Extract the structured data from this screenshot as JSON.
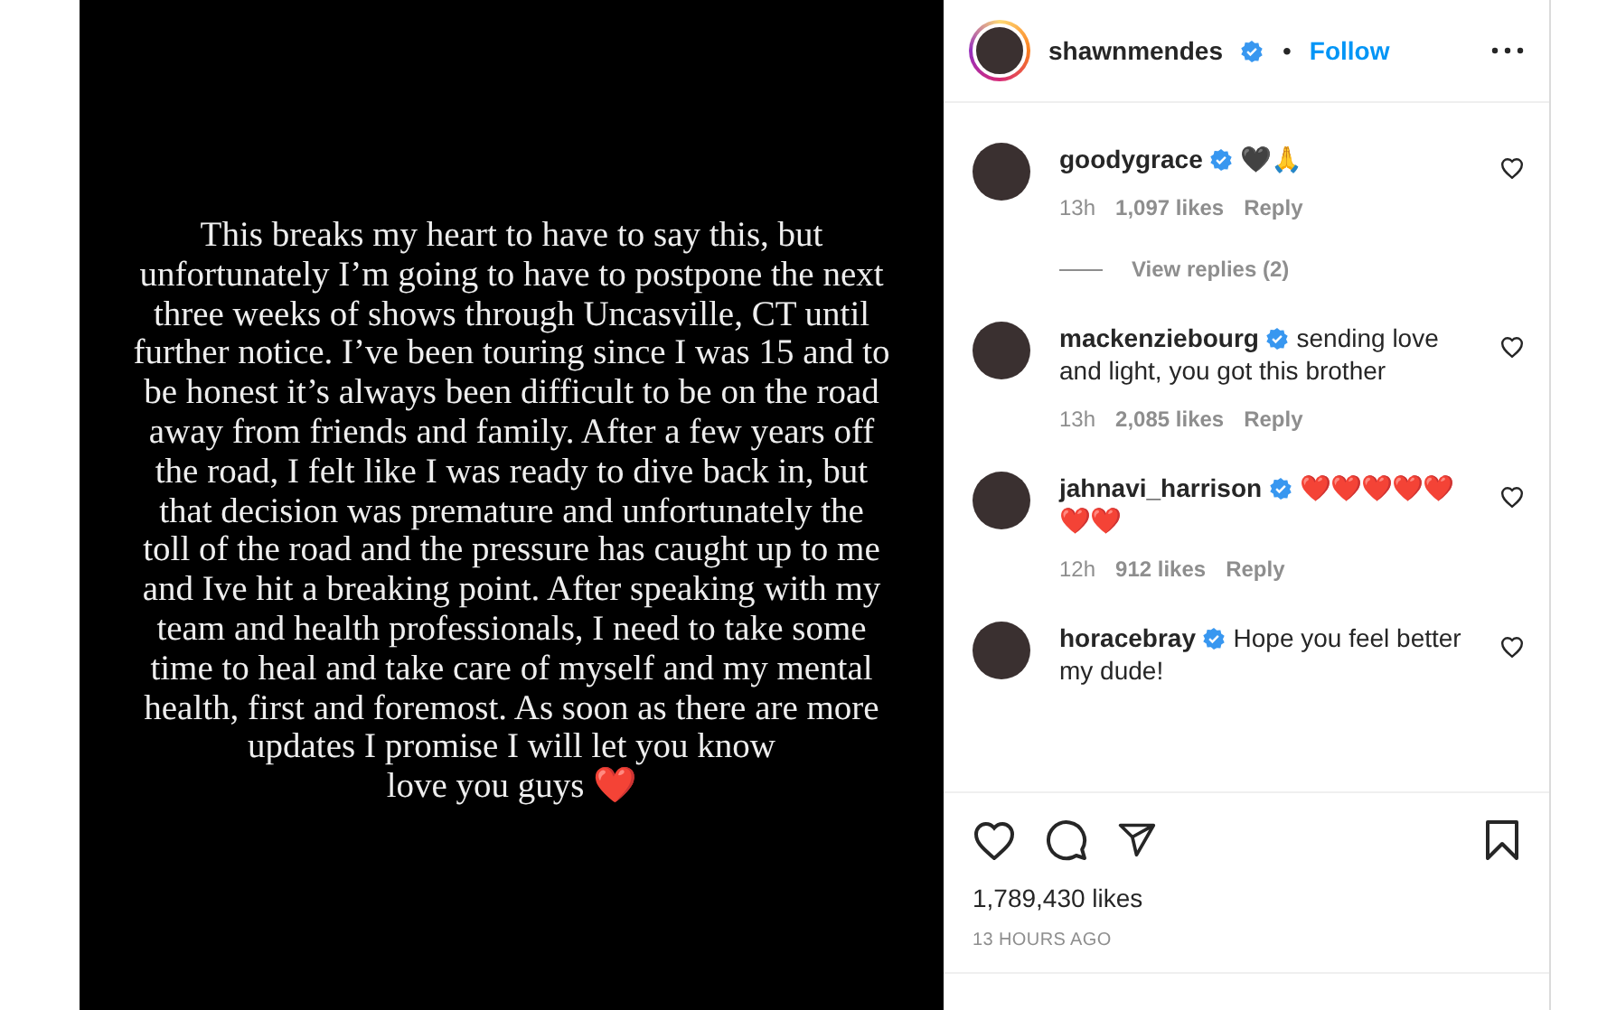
{
  "post_text": [
    "This breaks my heart to have to say this, but",
    "unfortunately I’m going to have to postpone the next",
    "three weeks of shows through Uncasville, CT until",
    "further notice. I’ve been touring since I was 15 and to",
    "be honest it’s always been difficult to be on the road",
    "away from friends and family. After a few years off",
    "the road, I felt like I was ready to dive back in, but",
    "that decision was premature and unfortunately the",
    "toll of the road and the pressure has caught up to me",
    "and Ive hit a breaking point. After speaking with my",
    "team and health professionals, I need to take some",
    "time to heal and take care of myself and my mental",
    "health, first and foremost. As soon as there are more",
    "updates I promise I will let you know",
    "love you guys ❤️"
  ],
  "header": {
    "username": "shawnmendes",
    "verified": true,
    "separator": "•",
    "follow": "Follow"
  },
  "comments": [
    {
      "username": "goodygrace",
      "verified": true,
      "text": [
        "🖤🙏"
      ],
      "time": "13h",
      "likes": "1,097 likes",
      "reply": "Reply",
      "view_replies": "View replies (2)"
    },
    {
      "username": "mackenziebourg",
      "verified": true,
      "text": [
        "sending love",
        "and light, you got this brother"
      ],
      "time": "13h",
      "likes": "2,085 likes",
      "reply": "Reply"
    },
    {
      "username": "jahnavi_harrison",
      "verified": true,
      "text": [
        "❤️❤️❤️❤️❤️",
        "❤️❤️"
      ],
      "time": "12h",
      "likes": "912 likes",
      "reply": "Reply"
    },
    {
      "username": "horacebray",
      "verified": true,
      "text": [
        "Hope you feel better",
        "my dude!"
      ]
    }
  ],
  "likes": "1,789,430 likes",
  "time_ago": "13 HOURS AGO"
}
